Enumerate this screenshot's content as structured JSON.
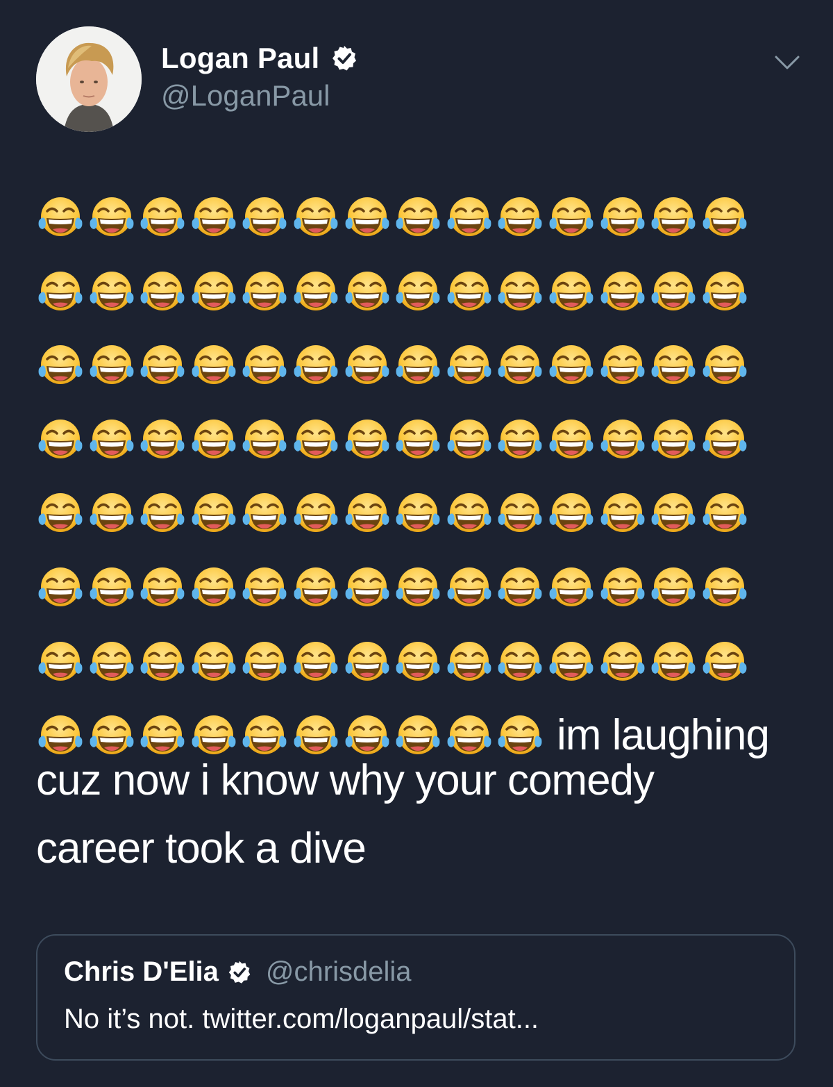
{
  "tweet": {
    "author_name": "Logan Paul",
    "author_handle": "@LoganPaul",
    "verified": true,
    "emoji": "face-with-tears-of-joy",
    "emoji_full_rows": 7,
    "emoji_per_row": 14,
    "emoji_last_row": 10,
    "text_inline": "im laughing",
    "text_line2": "cuz now i know why your comedy",
    "text_line3": "career took a dive"
  },
  "quoted_tweet": {
    "author_name": "Chris D'Elia",
    "author_handle": "@chrisdelia",
    "verified": true,
    "text": "No it’s not. twitter.com/loganpaul/stat..."
  },
  "colors": {
    "background": "#1c2230",
    "text": "#ffffff",
    "secondary_text": "#8899a6",
    "quote_border": "#3d4b5c"
  }
}
